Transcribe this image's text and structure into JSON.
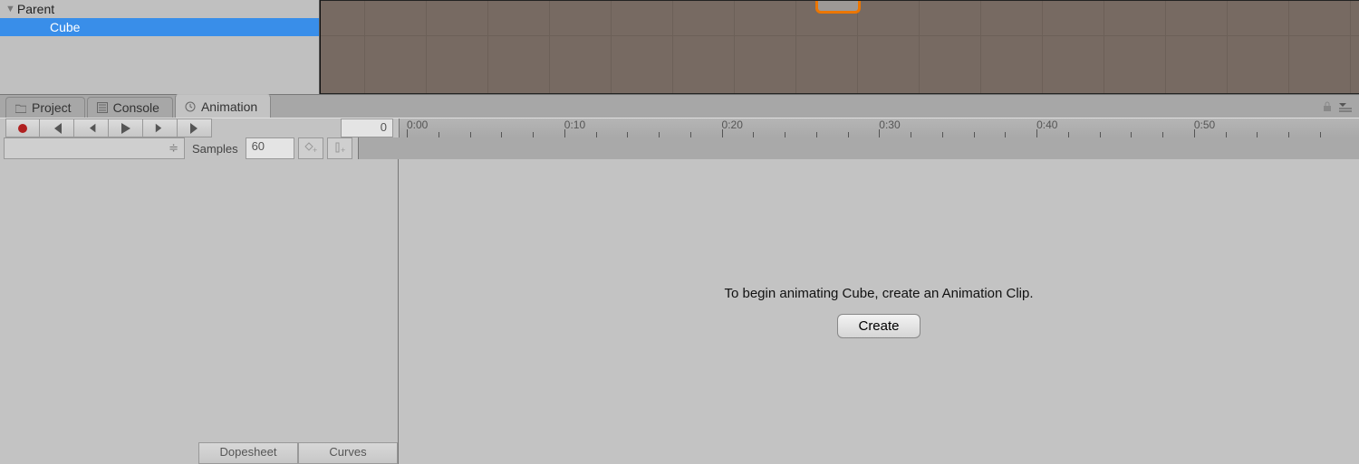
{
  "hierarchy": {
    "parent_label": "Parent",
    "child_label": "Cube"
  },
  "tabs": {
    "project": "Project",
    "console": "Console",
    "animation": "Animation"
  },
  "animation": {
    "frame": "0",
    "samples_label": "Samples",
    "samples_value": "60",
    "ruler_ticks": [
      "0:00",
      "0:10",
      "0:20",
      "0:30",
      "0:40",
      "0:50"
    ],
    "prompt": "To begin animating Cube, create an Animation Clip.",
    "create_label": "Create",
    "footer_dopesheet": "Dopesheet",
    "footer_curves": "Curves"
  }
}
